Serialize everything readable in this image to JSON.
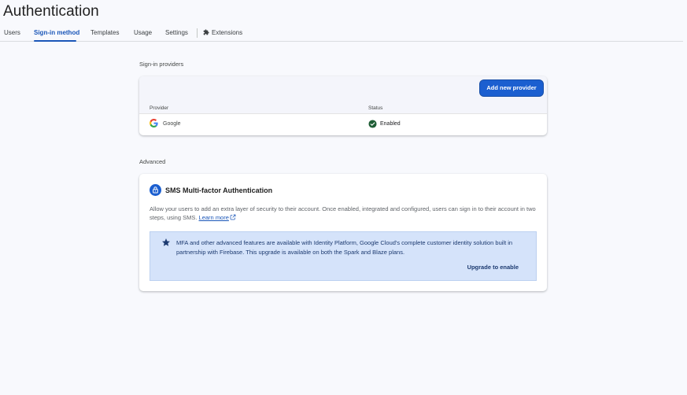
{
  "page": {
    "title": "Authentication"
  },
  "tabs": [
    {
      "label": "Users"
    },
    {
      "label": "Sign-in method"
    },
    {
      "label": "Templates"
    },
    {
      "label": "Usage"
    },
    {
      "label": "Settings"
    },
    {
      "label": "Extensions"
    }
  ],
  "active_tab": "Sign-in method",
  "sign_in_providers": {
    "section_label": "Sign-in providers",
    "add_button_label": "Add new provider",
    "columns": {
      "provider": "Provider",
      "status": "Status"
    },
    "rows": [
      {
        "provider": "Google",
        "status": "Enabled",
        "icon": "google-icon",
        "status_icon": "check-circle-icon"
      }
    ]
  },
  "advanced": {
    "section_label": "Advanced",
    "mfa": {
      "title": "SMS Multi-factor Authentication",
      "description": "Allow your users to add an extra layer of security to their account. Once enabled, integrated and configured, users can sign in to their account in two steps, using SMS.",
      "learn_more": "Learn more",
      "banner_text": "MFA and other advanced features are available with Identity Platform, Google Cloud's complete customer identity solution built in partnership with Firebase. This upgrade is available on both the Spark and Blaze plans.",
      "upgrade_label": "Upgrade to enable"
    }
  },
  "colors": {
    "accent": "#1a56b8",
    "primary_button": "#1b5fd0",
    "banner_bg": "#d5e3fa",
    "enabled_green": "#188038",
    "page_bg": "#f8f9fd"
  }
}
